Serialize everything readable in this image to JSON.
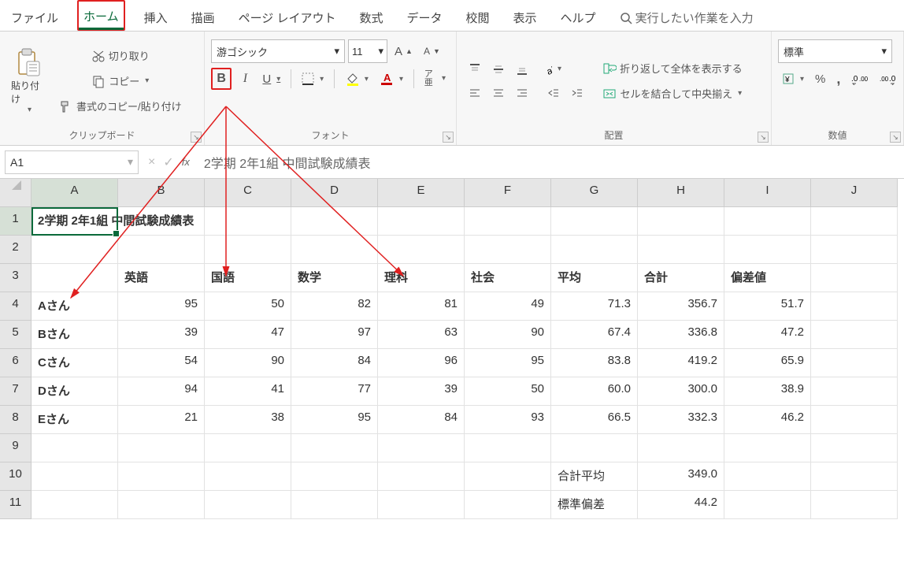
{
  "tabs": {
    "file": "ファイル",
    "home": "ホーム",
    "insert": "挿入",
    "draw": "描画",
    "pagelayout": "ページ レイアウト",
    "formulas": "数式",
    "data": "データ",
    "review": "校閲",
    "view": "表示",
    "help": "ヘルプ",
    "search_hint": "実行したい作業を入力"
  },
  "clipboard": {
    "paste": "貼り付け",
    "cut": "切り取り",
    "copy": "コピー",
    "format_painter": "書式のコピー/貼り付け",
    "group_label": "クリップボード"
  },
  "font": {
    "name": "游ゴシック",
    "size": "11",
    "group_label": "フォント",
    "ruby": "ア亜"
  },
  "alignment": {
    "wrap": "折り返して全体を表示する",
    "merge": "セルを結合して中央揃え",
    "group_label": "配置"
  },
  "number": {
    "format": "標準",
    "group_label": "数値"
  },
  "formula_bar": {
    "namebox": "A1",
    "fx_value": "2学期 2年1組 中間試験成績表"
  },
  "sheet": {
    "cols": [
      "A",
      "B",
      "C",
      "D",
      "E",
      "F",
      "G",
      "H",
      "I",
      "J"
    ],
    "title": "2学期 2年1組 中間試験成績表",
    "headers": {
      "b": "英語",
      "c": "国語",
      "d": "数学",
      "e": "理科",
      "f": "社会",
      "g": "平均",
      "h": "合計",
      "i": "偏差値"
    },
    "rows": [
      {
        "name": "Aさん",
        "b": "95",
        "c": "50",
        "d": "82",
        "e": "81",
        "f": "49",
        "g": "71.3",
        "h": "356.7",
        "i": "51.7"
      },
      {
        "name": "Bさん",
        "b": "39",
        "c": "47",
        "d": "97",
        "e": "63",
        "f": "90",
        "g": "67.4",
        "h": "336.8",
        "i": "47.2"
      },
      {
        "name": "Cさん",
        "b": "54",
        "c": "90",
        "d": "84",
        "e": "96",
        "f": "95",
        "g": "83.8",
        "h": "419.2",
        "i": "65.9"
      },
      {
        "name": "Dさん",
        "b": "94",
        "c": "41",
        "d": "77",
        "e": "39",
        "f": "50",
        "g": "60.0",
        "h": "300.0",
        "i": "38.9"
      },
      {
        "name": "Eさん",
        "b": "21",
        "c": "38",
        "d": "95",
        "e": "84",
        "f": "93",
        "g": "66.5",
        "h": "332.3",
        "i": "46.2"
      }
    ],
    "summary": {
      "total_avg_label": "合計平均",
      "total_avg": "349.0",
      "stddev_label": "標準偏差",
      "stddev": "44.2"
    },
    "row_labels": [
      "1",
      "2",
      "3",
      "4",
      "5",
      "6",
      "7",
      "8",
      "9",
      "10",
      "11"
    ]
  }
}
